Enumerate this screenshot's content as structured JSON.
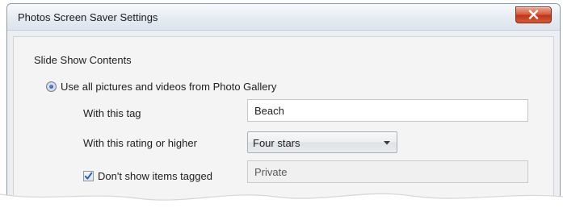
{
  "window": {
    "title": "Photos Screen Saver Settings"
  },
  "section": {
    "title": "Slide Show Contents"
  },
  "source_option": {
    "label": "Use all pictures and videos from Photo Gallery",
    "selected": true
  },
  "tag_filter": {
    "label": "With this tag",
    "value": "Beach"
  },
  "rating_filter": {
    "label": "With this rating or higher",
    "selected": "Four stars"
  },
  "exclude_filter": {
    "label": "Don't show items tagged",
    "checked": true,
    "value": "Private"
  },
  "icons": {
    "close": "close-icon",
    "dropdown": "chevron-down-icon",
    "check": "checkmark-icon"
  },
  "colors": {
    "close_button": "#c13414",
    "radio_dot": "#1b4d9c",
    "check": "#1f5fb3"
  }
}
